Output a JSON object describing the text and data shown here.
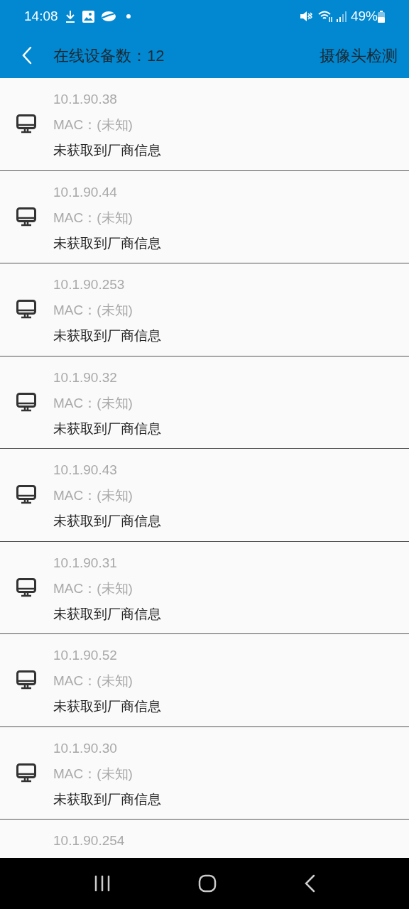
{
  "status_bar": {
    "time": "14:08",
    "battery": "49%"
  },
  "app_bar": {
    "title": "在线设备数：12",
    "action": "摄像头检测"
  },
  "devices": [
    {
      "ip": "10.1.90.38",
      "mac": "MAC：(未知)",
      "vendor": "未获取到厂商信息"
    },
    {
      "ip": "10.1.90.44",
      "mac": "MAC：(未知)",
      "vendor": "未获取到厂商信息"
    },
    {
      "ip": "10.1.90.253",
      "mac": "MAC：(未知)",
      "vendor": "未获取到厂商信息"
    },
    {
      "ip": "10.1.90.32",
      "mac": "MAC：(未知)",
      "vendor": "未获取到厂商信息"
    },
    {
      "ip": "10.1.90.43",
      "mac": "MAC：(未知)",
      "vendor": "未获取到厂商信息"
    },
    {
      "ip": "10.1.90.31",
      "mac": "MAC：(未知)",
      "vendor": "未获取到厂商信息"
    },
    {
      "ip": "10.1.90.52",
      "mac": "MAC：(未知)",
      "vendor": "未获取到厂商信息"
    },
    {
      "ip": "10.1.90.30",
      "mac": "MAC：(未知)",
      "vendor": "未获取到厂商信息"
    },
    {
      "ip": "10.1.90.254"
    }
  ]
}
